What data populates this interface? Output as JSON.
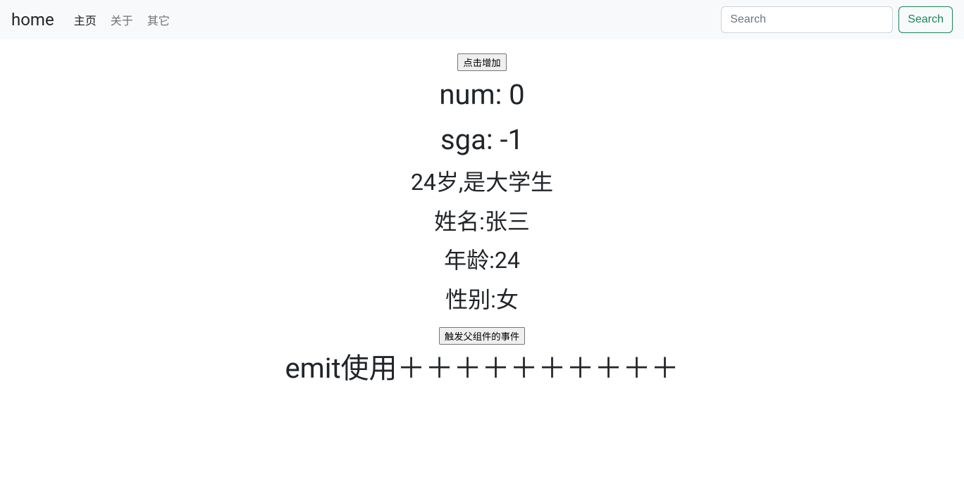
{
  "navbar": {
    "brand": "home",
    "links": [
      {
        "label": "主页",
        "active": true
      },
      {
        "label": "关于",
        "active": false
      },
      {
        "label": "其它",
        "active": false
      }
    ],
    "search": {
      "placeholder": "Search",
      "value": "",
      "button_label": "Search"
    }
  },
  "main": {
    "increment_button": "点击增加",
    "num_line": "num: 0",
    "sga_line": "sga: -1",
    "student_line": "24岁,是大学生",
    "name_line": "姓名:张三",
    "age_line": "年龄:24",
    "gender_line": "性别:女",
    "trigger_button": "触发父组件的事件",
    "emit_line": "emit使用＋＋＋＋＋＋＋＋＋＋"
  }
}
